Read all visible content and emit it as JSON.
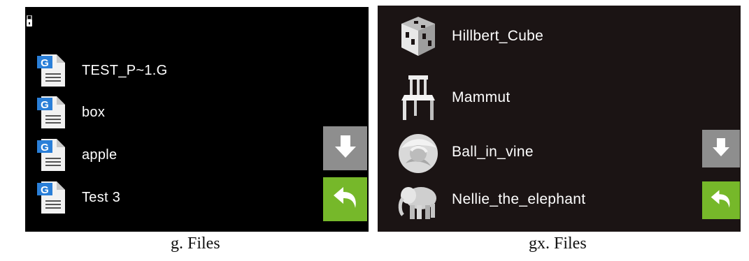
{
  "panels": {
    "g": {
      "usb_icon": "usb-drive-icon",
      "files": [
        {
          "name": "TEST_P~1.G",
          "icon": "gcode-file-icon"
        },
        {
          "name": "box",
          "icon": "gcode-file-icon"
        },
        {
          "name": "apple",
          "icon": "gcode-file-icon"
        },
        {
          "name": "Test 3",
          "icon": "gcode-file-icon"
        }
      ],
      "scroll_down_icon": "arrow-down-icon",
      "back_icon": "back-arrow-icon",
      "caption": "g. Files"
    },
    "gx": {
      "files": [
        {
          "name": "Hillbert_Cube",
          "icon": "hilbert-cube-model-thumbnail"
        },
        {
          "name": "Mammut",
          "icon": "chair-model-thumbnail"
        },
        {
          "name": "Ball_in_vine",
          "icon": "ball-model-thumbnail"
        },
        {
          "name": "Nellie_the_elephant",
          "icon": "elephant-model-thumbnail"
        }
      ],
      "scroll_down_icon": "arrow-down-icon",
      "back_icon": "back-arrow-icon",
      "caption": "gx. Files"
    }
  },
  "colors": {
    "g_background": "#000000",
    "gx_background": "#1b1414",
    "scroll_button": "#8e8e8e",
    "back_button": "#76b82a",
    "gcode_icon_blue": "#2a7fd8"
  }
}
